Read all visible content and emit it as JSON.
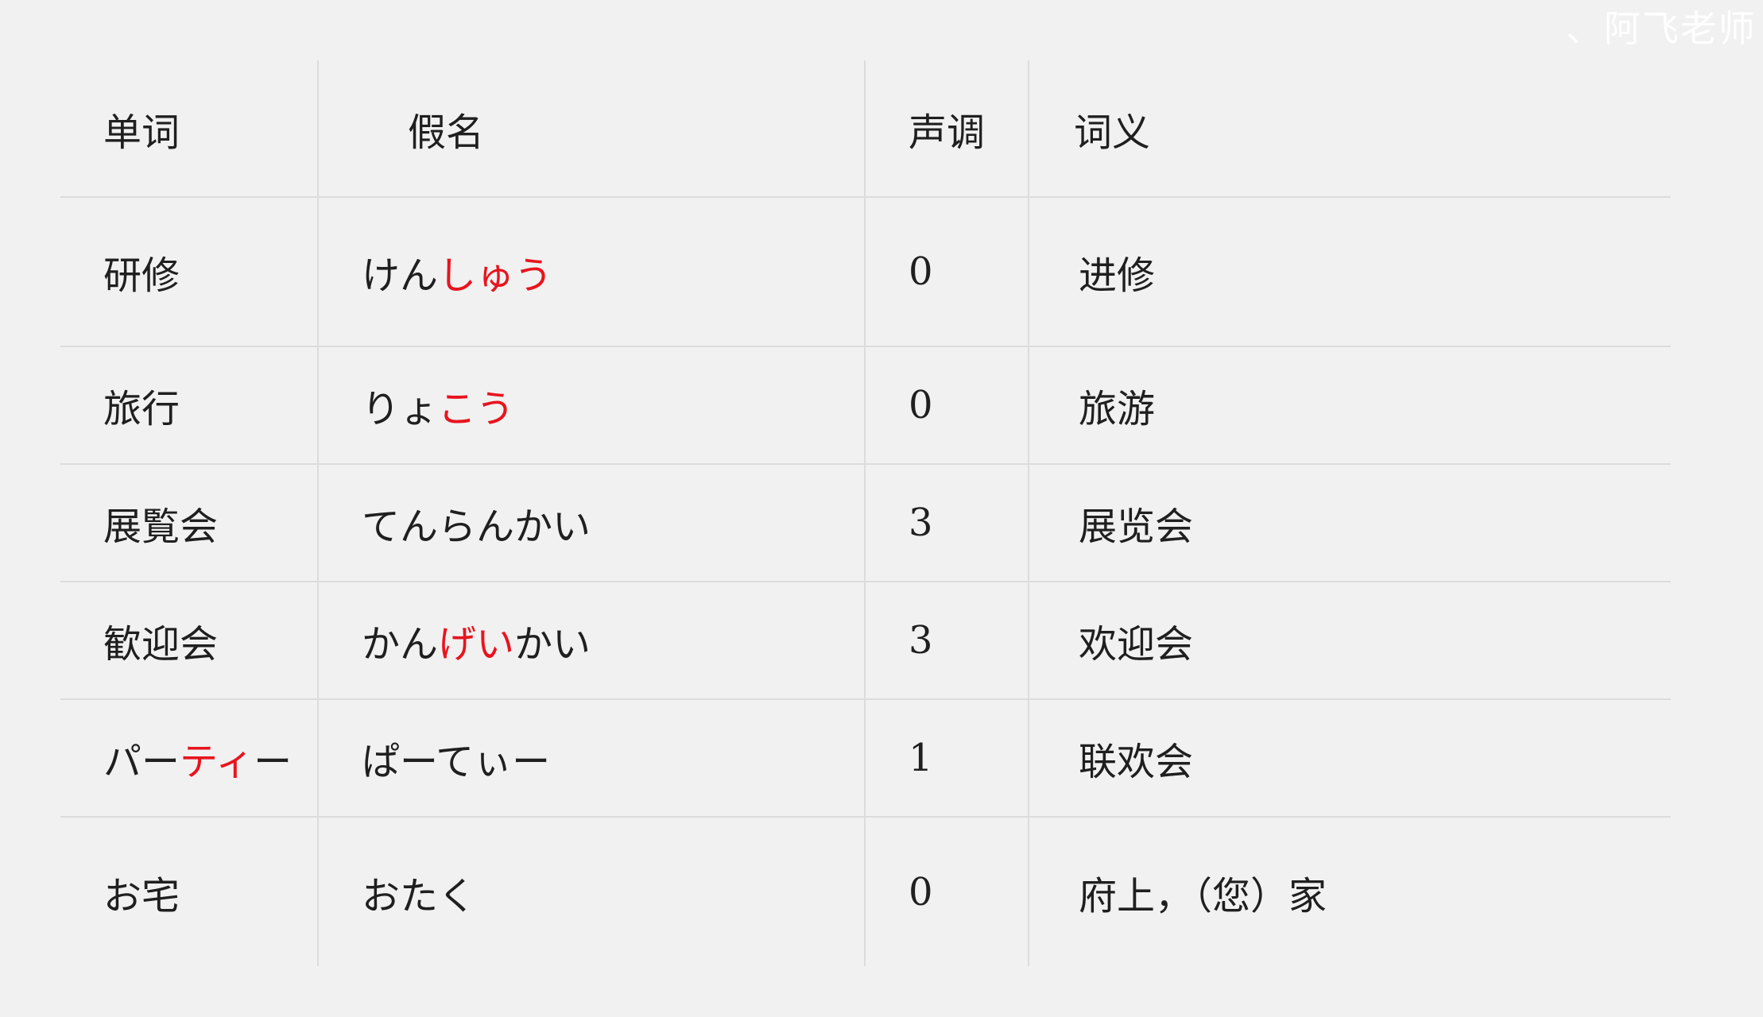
{
  "watermark": "、阿飞老师",
  "headers": {
    "word": "单词",
    "kana": "假名",
    "tone": "声调",
    "meaning": "词义"
  },
  "rows": [
    {
      "word": [
        {
          "t": "研修",
          "hl": false
        }
      ],
      "kana": [
        {
          "t": "けん",
          "hl": false
        },
        {
          "t": "しゅう",
          "hl": true
        }
      ],
      "tone": "0",
      "meaning": "进修"
    },
    {
      "word": [
        {
          "t": "旅行",
          "hl": false
        }
      ],
      "kana": [
        {
          "t": "りょ",
          "hl": false
        },
        {
          "t": "こう",
          "hl": true
        }
      ],
      "tone": "0",
      "meaning": "旅游"
    },
    {
      "word": [
        {
          "t": "展覧会",
          "hl": false
        }
      ],
      "kana": [
        {
          "t": "てんらんかい",
          "hl": false
        }
      ],
      "tone": "3",
      "meaning": "展览会"
    },
    {
      "word": [
        {
          "t": "歓迎会",
          "hl": false
        }
      ],
      "kana": [
        {
          "t": "かん",
          "hl": false
        },
        {
          "t": "げい",
          "hl": true
        },
        {
          "t": "かい",
          "hl": false
        }
      ],
      "tone": "3",
      "meaning": "欢迎会"
    },
    {
      "word": [
        {
          "t": "パー",
          "hl": false
        },
        {
          "t": "ティ",
          "hl": true
        },
        {
          "t": "ー",
          "hl": false
        }
      ],
      "kana": [
        {
          "t": "ぱーてぃー",
          "hl": false
        }
      ],
      "tone": "1",
      "meaning": "联欢会"
    },
    {
      "word": [
        {
          "t": "お宅",
          "hl": false
        }
      ],
      "kana": [
        {
          "t": "おたく",
          "hl": false
        }
      ],
      "tone": "0",
      "meaning": "府上，（您）家"
    }
  ],
  "colors": {
    "background": "#f1f1f1",
    "text": "#1f1f1f",
    "highlight": "#e8141e",
    "rule": "#dcdcdc"
  }
}
